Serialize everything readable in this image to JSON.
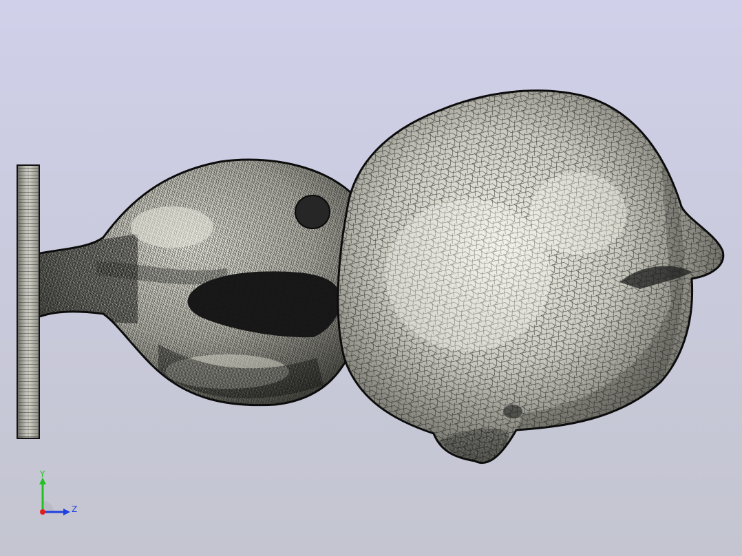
{
  "viewport": {
    "background_top": "#d0d0ea",
    "background_bottom": "#c4c5d0",
    "display_mode": "shaded-with-mesh-edges"
  },
  "model": {
    "surface_color": "#c8c8be",
    "mesh_edge_color": "#141414",
    "parts": [
      "base-plate",
      "neck",
      "front-bulb",
      "rear-bulb"
    ]
  },
  "triad": {
    "y_label": "Y",
    "z_label": "Z",
    "y_color": "#22c022",
    "z_color": "#2040e0",
    "x_color": "#e02020"
  }
}
